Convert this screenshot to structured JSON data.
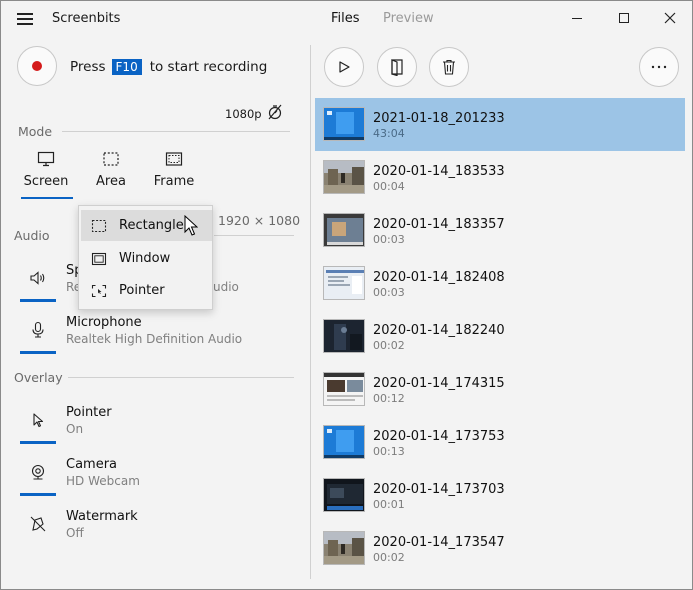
{
  "app": {
    "title": "Screenbits"
  },
  "tabs": {
    "files": "Files",
    "preview": "Preview"
  },
  "record": {
    "press": "Press",
    "key": "F10",
    "suffix": "to start recording"
  },
  "quality": {
    "resolution": "1080p"
  },
  "mode": {
    "label": "Mode",
    "buttons": [
      "Screen",
      "Area",
      "Frame"
    ],
    "selected": "Screen",
    "area_resolution": "1920 × 1080"
  },
  "dropdown": {
    "items": [
      "Rectangle",
      "Window",
      "Pointer"
    ],
    "highlighted": "Rectangle"
  },
  "audio": {
    "label": "Audio",
    "speakers": {
      "title": "Sp",
      "subtitle_prefix": "Re",
      "subtitle_suffix": "udio"
    },
    "microphone": {
      "title": "Microphone",
      "subtitle": "Realtek High Definition Audio"
    }
  },
  "overlay": {
    "label": "Overlay",
    "pointer": {
      "title": "Pointer",
      "status": "On"
    },
    "camera": {
      "title": "Camera",
      "status": "HD Webcam"
    },
    "watermark": {
      "title": "Watermark",
      "status": "Off"
    }
  },
  "files": [
    {
      "name": "2021-01-18_201233",
      "duration": "43:04",
      "selected": true,
      "thumb": "windows-desktop"
    },
    {
      "name": "2020-01-14_183533",
      "duration": "00:04",
      "selected": false,
      "thumb": "game-street"
    },
    {
      "name": "2020-01-14_183357",
      "duration": "00:03",
      "selected": false,
      "thumb": "game-map"
    },
    {
      "name": "2020-01-14_182408",
      "duration": "00:03",
      "selected": false,
      "thumb": "document-window"
    },
    {
      "name": "2020-01-14_182240",
      "duration": "00:02",
      "selected": false,
      "thumb": "dark-scene"
    },
    {
      "name": "2020-01-14_174315",
      "duration": "00:12",
      "selected": false,
      "thumb": "webpage"
    },
    {
      "name": "2020-01-14_173753",
      "duration": "00:13",
      "selected": false,
      "thumb": "windows-desktop"
    },
    {
      "name": "2020-01-14_173703",
      "duration": "00:01",
      "selected": false,
      "thumb": "dark-window"
    },
    {
      "name": "2020-01-14_173547",
      "duration": "00:02",
      "selected": false,
      "thumb": "game-street"
    }
  ],
  "colors": {
    "accent": "#0a63c4",
    "selection": "#9cc4e6",
    "record": "#d41a1a"
  }
}
